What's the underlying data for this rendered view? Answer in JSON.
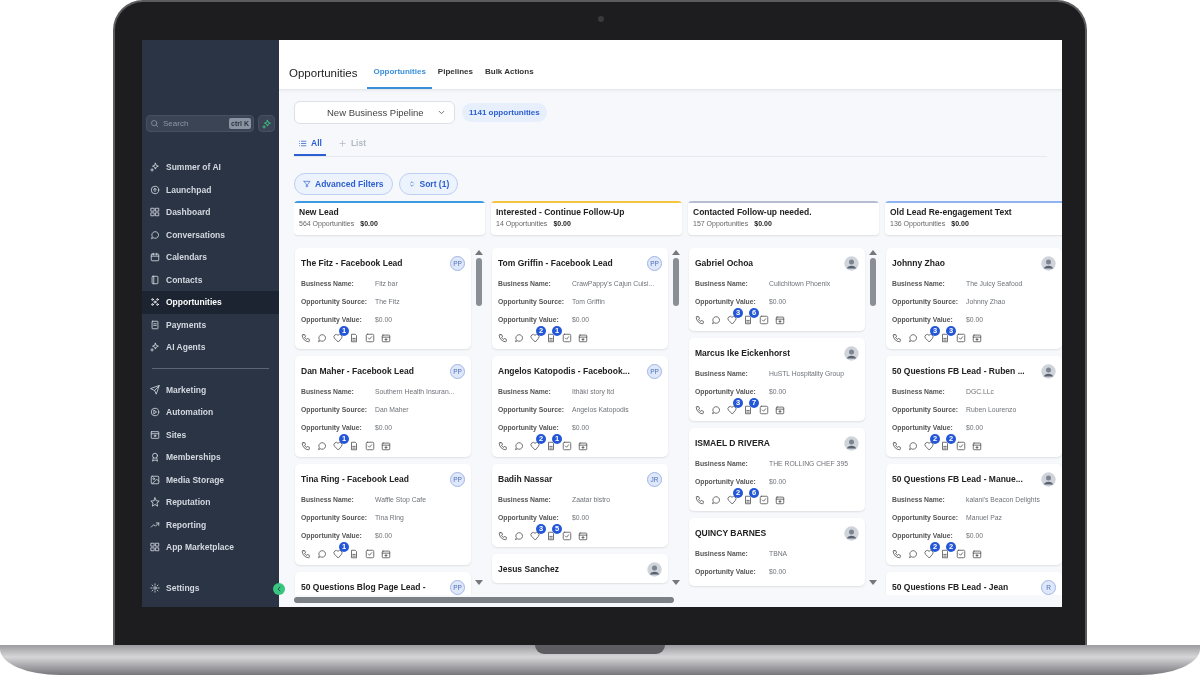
{
  "sidebar": {
    "search": {
      "placeholder": "Search",
      "shortcut": "ctrl K"
    },
    "sections": [
      {
        "items": [
          {
            "label": "Summer of AI",
            "selected": false
          },
          {
            "label": "Launchpad",
            "selected": false
          },
          {
            "label": "Dashboard",
            "selected": false
          },
          {
            "label": "Conversations",
            "selected": false
          },
          {
            "label": "Calendars",
            "selected": false
          },
          {
            "label": "Contacts",
            "selected": false
          },
          {
            "label": "Opportunities",
            "selected": true
          },
          {
            "label": "Payments",
            "selected": false
          },
          {
            "label": "AI Agents",
            "selected": false
          }
        ]
      },
      {
        "items": [
          {
            "label": "Marketing",
            "selected": false
          },
          {
            "label": "Automation",
            "selected": false
          },
          {
            "label": "Sites",
            "selected": false
          },
          {
            "label": "Memberships",
            "selected": false
          },
          {
            "label": "Media Storage",
            "selected": false
          },
          {
            "label": "Reputation",
            "selected": false
          },
          {
            "label": "Reporting",
            "selected": false
          },
          {
            "label": "App Marketplace",
            "selected": false
          }
        ]
      }
    ],
    "footer": {
      "label": "Settings"
    }
  },
  "header": {
    "title": "Opportunities",
    "tabs": [
      {
        "label": "Opportunities",
        "selected": true
      },
      {
        "label": "Pipelines",
        "selected": false
      },
      {
        "label": "Bulk Actions",
        "selected": false
      }
    ]
  },
  "pipeline": {
    "value": "New Business Pipeline",
    "count": "1141 opportunities"
  },
  "views": [
    {
      "label": "All",
      "selected": true,
      "kind": "list"
    },
    {
      "label": "List",
      "selected": false,
      "kind": "add"
    }
  ],
  "filters": [
    {
      "label": "Advanced Filters",
      "kind": "filter"
    },
    {
      "label": "Sort (1)",
      "kind": "sort"
    }
  ],
  "columns": [
    {
      "title": "New Lead",
      "count": "564 Opportunities",
      "amount": "$0.00",
      "color": "#3b9ae1",
      "cards": [
        {
          "kind": "full",
          "title": "The Fitz - Facebook Lead",
          "avatar": {
            "kind": "initials",
            "text": "PP"
          },
          "fields": [
            {
              "label": "Business Name:",
              "value": "Fitz bar"
            },
            {
              "label": "Opportunity Source:",
              "value": "The Fitz"
            },
            {
              "label": "Opportunity Value:",
              "value": "$0.00"
            }
          ],
          "tag_count": "1"
        },
        {
          "kind": "full",
          "title": "Dan Maher - Facebook Lead",
          "avatar": {
            "kind": "initials",
            "text": "PP"
          },
          "fields": [
            {
              "label": "Business Name:",
              "value": "Southern Health Insuran..."
            },
            {
              "label": "Opportunity Source:",
              "value": "Dan Maher"
            },
            {
              "label": "Opportunity Value:",
              "value": "$0.00"
            }
          ],
          "tag_count": "1"
        },
        {
          "kind": "full",
          "title": "Tina Ring - Facebook Lead",
          "avatar": {
            "kind": "initials",
            "text": "PP"
          },
          "fields": [
            {
              "label": "Business Name:",
              "value": "Waffle Stop Cafe"
            },
            {
              "label": "Opportunity Source:",
              "value": "Tina Ring"
            },
            {
              "label": "Opportunity Value:",
              "value": "$0.00"
            }
          ],
          "tag_count": "1"
        },
        {
          "kind": "partial",
          "title": "50 Questions Blog Page Lead -",
          "avatar": {
            "kind": "initials",
            "text": "PP"
          }
        }
      ]
    },
    {
      "title": "Interested - Continue Follow-Up",
      "count": "14 Opportunities",
      "amount": "$0.00",
      "color": "#f5c542",
      "cards": [
        {
          "kind": "full",
          "title": "Tom Griffin - Facebook Lead",
          "avatar": {
            "kind": "initials",
            "text": "PP"
          },
          "fields": [
            {
              "label": "Business Name:",
              "value": "CrawPappy's Cajun Cuisi..."
            },
            {
              "label": "Opportunity Source:",
              "value": "Tom Griffin"
            },
            {
              "label": "Opportunity Value:",
              "value": "$0.00"
            }
          ],
          "tag_count": "2",
          "note_count": "1"
        },
        {
          "kind": "full",
          "title": "Angelos Katopodis - Facebook...",
          "avatar": {
            "kind": "initials",
            "text": "PP"
          },
          "fields": [
            {
              "label": "Business Name:",
              "value": "Ithâki story ltd"
            },
            {
              "label": "Opportunity Source:",
              "value": "Angelos Katopodis"
            },
            {
              "label": "Opportunity Value:",
              "value": "$0.00"
            }
          ],
          "tag_count": "2",
          "note_count": "1"
        },
        {
          "kind": "full",
          "title": "Badih Nassar",
          "avatar": {
            "kind": "initials",
            "text": "JR"
          },
          "fields": [
            {
              "label": "Business Name:",
              "value": "Zaatar bistro"
            },
            {
              "label": "Opportunity Value:",
              "value": "$0.00"
            }
          ],
          "tag_count": "3",
          "note_count": "5"
        },
        {
          "kind": "partial",
          "title": "Jesus Sanchez",
          "avatar": {
            "kind": "photo"
          }
        }
      ]
    },
    {
      "title": "Contacted Follow-up needed.",
      "count": "157 Opportunities",
      "amount": "$0.00",
      "color": "#b6bdd3",
      "cards": [
        {
          "kind": "full",
          "title": "Gabriel Ochoa",
          "avatar": {
            "kind": "photo"
          },
          "fields": [
            {
              "label": "Business Name:",
              "value": "Culichitown Phoenix"
            },
            {
              "label": "Opportunity Value:",
              "value": "$0.00"
            }
          ],
          "tag_count": "3",
          "note_count": "6"
        },
        {
          "kind": "full",
          "title": "Marcus Ike Eickenhorst",
          "avatar": {
            "kind": "photo"
          },
          "fields": [
            {
              "label": "Business Name:",
              "value": "HuSTL Hospitality Group"
            },
            {
              "label": "Opportunity Value:",
              "value": "$0.00"
            }
          ],
          "tag_count": "3",
          "note_count": "7"
        },
        {
          "kind": "full",
          "title": "ISMAEL D RIVERA",
          "avatar": {
            "kind": "photo"
          },
          "fields": [
            {
              "label": "Business Name:",
              "value": "THE ROLLING CHEF 395"
            },
            {
              "label": "Opportunity Value:",
              "value": "$0.00"
            }
          ],
          "tag_count": "2",
          "note_count": "6"
        },
        {
          "kind": "partial",
          "title": "QUINCY BARNES",
          "avatar": {
            "kind": "photo"
          },
          "fields": [
            {
              "label": "Business Name:",
              "value": "TBNA"
            },
            {
              "label": "Opportunity Value:",
              "value": "$0.00"
            }
          ]
        }
      ]
    },
    {
      "title": "Old Lead Re-engagement Text",
      "count": "136 Opportunities",
      "amount": "$0.00",
      "color": "#8fb3f0",
      "cards": [
        {
          "kind": "full",
          "title": "Johnny Zhao",
          "avatar": {
            "kind": "photo"
          },
          "fields": [
            {
              "label": "Business Name:",
              "value": "The Juicy Seafood"
            },
            {
              "label": "Opportunity Source:",
              "value": "Johnny Zhao"
            },
            {
              "label": "Opportunity Value:",
              "value": "$0.00"
            }
          ],
          "tag_count": "3",
          "note_count": "3"
        },
        {
          "kind": "full",
          "title": "50 Questions FB Lead - Ruben ...",
          "avatar": {
            "kind": "photo"
          },
          "fields": [
            {
              "label": "Business Name:",
              "value": "DGC.LLc"
            },
            {
              "label": "Opportunity Source:",
              "value": "Ruben Lourenzo"
            },
            {
              "label": "Opportunity Value:",
              "value": "$0.00"
            }
          ],
          "tag_count": "2",
          "note_count": "2"
        },
        {
          "kind": "full",
          "title": "50 Questions FB Lead - Manue...",
          "avatar": {
            "kind": "photo"
          },
          "fields": [
            {
              "label": "Business Name:",
              "value": "kalani's Beacon Delights"
            },
            {
              "label": "Opportunity Source:",
              "value": "Manuel Paz"
            },
            {
              "label": "Opportunity Value:",
              "value": "$0.00"
            }
          ],
          "tag_count": "2",
          "note_count": "2"
        },
        {
          "kind": "partial",
          "title": "50 Questions FB Lead - Jean",
          "avatar": {
            "kind": "initials",
            "text": "R"
          }
        }
      ]
    }
  ]
}
